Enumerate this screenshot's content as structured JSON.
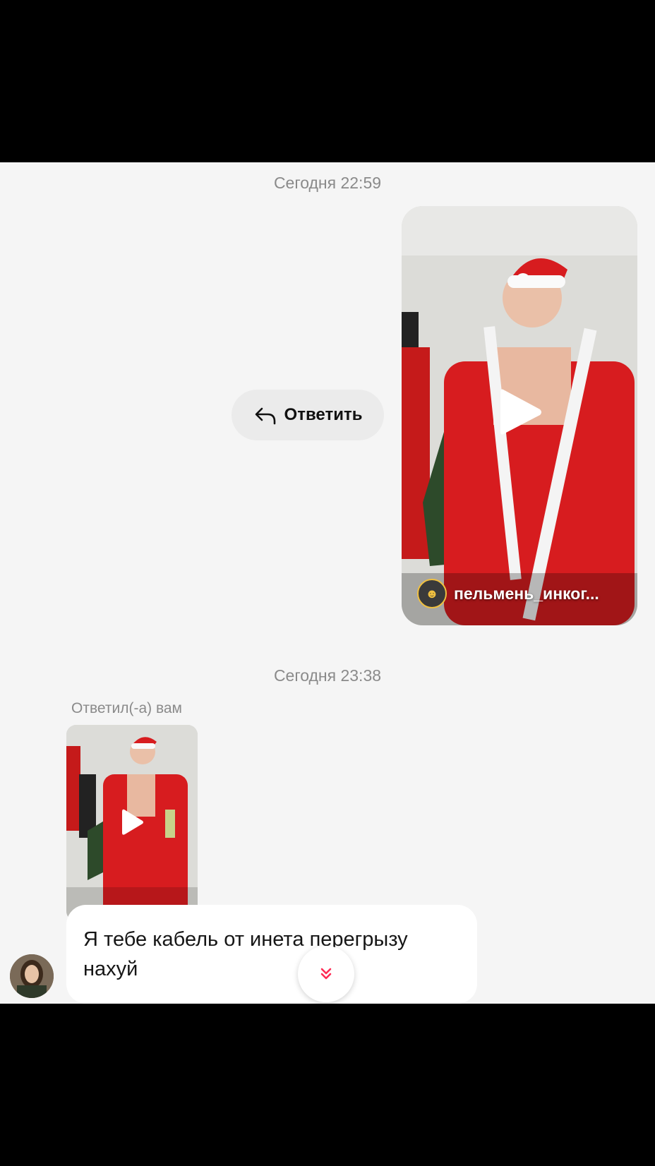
{
  "chat": {
    "timestamp_1": "Сегодня 22:59",
    "timestamp_2": "Сегодня 23:38",
    "reply_button_label": "Ответить",
    "shared_video": {
      "author_name": "пельмень_инког...",
      "author_avatar_icon": "author-avatar-icon"
    },
    "replied_label": "Ответил(-а) вам",
    "incoming_message": {
      "text": "Я тебе кабель от инета перегрызу нахуй"
    }
  },
  "colors": {
    "chat_background": "#f5f5f5",
    "bubble_background": "#ffffff",
    "timestamp_color": "#8a8a8a",
    "reply_pill_background": "#ebebeb",
    "accent_red": "#fe2c55"
  },
  "icons": {
    "reply": "reply-arrow-icon",
    "play": "play-icon",
    "scroll_down": "chevron-double-down-icon"
  }
}
